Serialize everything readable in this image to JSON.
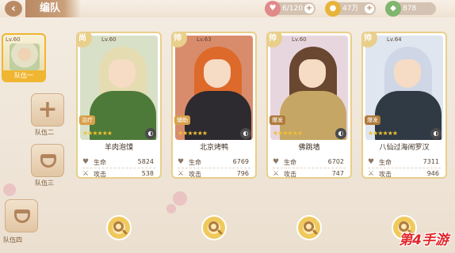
{
  "header": {
    "title": "编队",
    "resources": [
      {
        "icon": "heart-icon",
        "value": "6/120",
        "color": "#e08a8a"
      },
      {
        "icon": "coin-icon",
        "value": "47万",
        "color": "#e7b43a"
      },
      {
        "icon": "gem-icon",
        "value": "878",
        "color": "#7fb56d"
      }
    ]
  },
  "teams": {
    "active": {
      "level": "Lv.60",
      "label": "队伍一"
    },
    "items": [
      {
        "label": "队伍二",
        "icon": "plus"
      },
      {
        "label": "队伍三",
        "icon": "cup"
      },
      {
        "label": "队伍四",
        "icon": "cup"
      }
    ]
  },
  "cards": [
    {
      "rank": "尚",
      "level": "Lv.60",
      "name": "羊肉泡馍",
      "badge": "治疗",
      "hp_label": "生命",
      "hp": "5824",
      "atk_label": "攻击",
      "atk": "538",
      "bg": "#d9e0c8",
      "hair": "#e5dcb2",
      "body": "#4e7a39",
      "badge_color": "#d8a04a"
    },
    {
      "rank": "帅",
      "level": "Lv.63",
      "name": "北京烤鸭",
      "badge": "辅助",
      "hp_label": "生命",
      "hp": "6769",
      "atk_label": "攻击",
      "atk": "796",
      "bg": "#d98c6c",
      "hair": "#dd6a2a",
      "body": "#2d2a30",
      "badge_color": "#d8a04a"
    },
    {
      "rank": "帅",
      "level": "Lv.60",
      "name": "佛跳墙",
      "badge": "爆发",
      "hp_label": "生命",
      "hp": "6702",
      "atk_label": "攻击",
      "atk": "747",
      "bg": "#e8d6df",
      "hair": "#6a4730",
      "body": "#c6a664",
      "badge_color": "#b07a3c"
    },
    {
      "rank": "帅",
      "level": "Lv.64",
      "name": "八仙过海闹罗汉",
      "badge": "爆发",
      "hp_label": "生命",
      "hp": "7311",
      "atk_label": "攻击",
      "atk": "946",
      "bg": "#dfe6ef",
      "hair": "#cfd6e6",
      "body": "#2f3a44",
      "badge_color": "#b07a3c"
    }
  ],
  "watermark": "第4手游"
}
